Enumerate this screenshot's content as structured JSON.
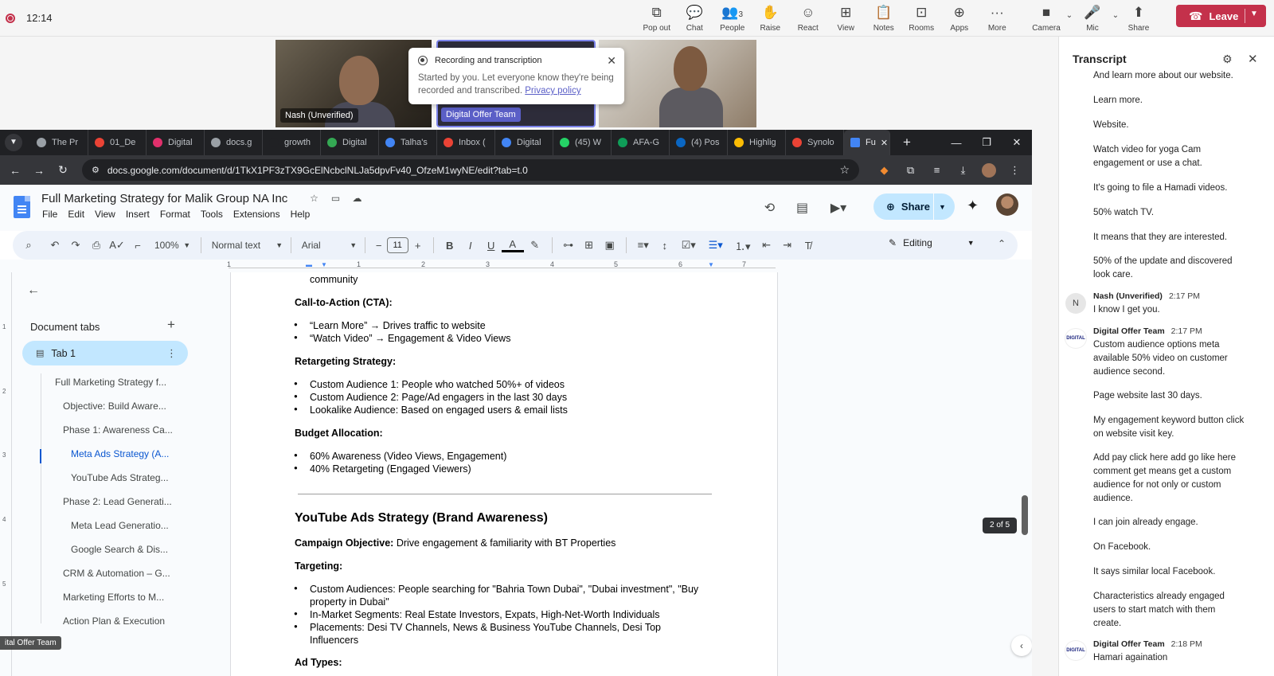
{
  "teams": {
    "clock": "12:14",
    "tools": [
      {
        "icon": "⧉",
        "label": "Pop out"
      },
      {
        "icon": "💬",
        "label": "Chat"
      },
      {
        "icon": "👥",
        "label": "People",
        "badge": "3"
      },
      {
        "icon": "✋",
        "label": "Raise"
      },
      {
        "icon": "☺",
        "label": "React"
      },
      {
        "icon": "⊞",
        "label": "View"
      },
      {
        "icon": "📋",
        "label": "Notes"
      },
      {
        "icon": "⊡",
        "label": "Rooms"
      },
      {
        "icon": "⊕",
        "label": "Apps"
      },
      {
        "icon": "···",
        "label": "More"
      }
    ],
    "av_tools": [
      {
        "icon": "■",
        "label": "Camera"
      },
      {
        "icon": "🎤",
        "label": "Mic"
      },
      {
        "icon": "⬆",
        "label": "Share"
      }
    ],
    "leave_label": "Leave",
    "colors": {
      "leave": "#c4314b",
      "accent": "#5b5fc7"
    }
  },
  "videos": [
    {
      "name": "Nash (Unverified)"
    },
    {
      "name": "Digital Offer Team"
    },
    {
      "name": ""
    }
  ],
  "recording_popup": {
    "title": "Recording and transcription",
    "body": "Started by you. Let everyone know they're being recorded and transcribed.",
    "link": "Privacy policy"
  },
  "chrome": {
    "tabs": [
      {
        "title": "The Pr",
        "color": "#9aa0a6"
      },
      {
        "title": "01_De",
        "color": "#ea4335"
      },
      {
        "title": "Digital",
        "color": "#e1306c"
      },
      {
        "title": "docs.g",
        "color": "#9aa0a6"
      },
      {
        "title": "growth",
        "color": "#202124"
      },
      {
        "title": "Digital",
        "color": "#34a853"
      },
      {
        "title": "Talha's",
        "color": "#4285f4"
      },
      {
        "title": "Inbox (",
        "color": "#ea4335"
      },
      {
        "title": "Digital",
        "color": "#4285f4"
      },
      {
        "title": "(45) W",
        "color": "#25d366"
      },
      {
        "title": "AFA-G",
        "color": "#0f9d58"
      },
      {
        "title": "(4) Pos",
        "color": "#0a66c2"
      },
      {
        "title": "Highlig",
        "color": "#fbbc04"
      },
      {
        "title": "Synolo",
        "color": "#ea4335"
      }
    ],
    "active_tab": "Fu",
    "url": "docs.google.com/document/d/1TkX1PF3zTX9GcElNcbclNLJa5dpvFv40_OfzeM1wyNE/edit?tab=t.0"
  },
  "docs": {
    "title": "Full Marketing Strategy for Malik Group NA Inc",
    "menu": [
      "File",
      "Edit",
      "View",
      "Insert",
      "Format",
      "Tools",
      "Extensions",
      "Help"
    ],
    "share_label": "Share",
    "zoom": "100%",
    "style": "Normal text",
    "font": "Arial",
    "font_size": "11",
    "mode": "Editing",
    "ruler_numbers": [
      "1",
      "1",
      "2",
      "3",
      "4",
      "5",
      "6",
      "7"
    ],
    "vruler_numbers": [
      "1",
      "2",
      "3",
      "4",
      "5"
    ],
    "outline": {
      "title": "Document tabs",
      "tab": "Tab 1",
      "items": [
        "Full Marketing Strategy f...",
        "Objective: Build Aware...",
        "Phase 1: Awareness Ca...",
        "Meta Ads Strategy (A...",
        "YouTube Ads Strateg...",
        "Phase 2: Lead Generati...",
        "Meta Lead Generatio...",
        "Google Search & Dis...",
        "CRM & Automation – G...",
        "Marketing Efforts to M...",
        "Action Plan & Execution"
      ]
    },
    "page": {
      "community": "community",
      "cta_heading": "Call-to-Action (CTA):",
      "cta_items": [
        "“Learn More” → Drives traffic to website",
        "“Watch Video” → Engagement & Video Views"
      ],
      "retargeting_heading": "Retargeting Strategy:",
      "retargeting_items": [
        "Custom Audience 1: People who watched 50%+ of videos",
        "Custom Audience 2: Page/Ad engagers in the last 30 days",
        "Lookalike Audience: Based on engaged users & email lists"
      ],
      "budget_heading": "Budget Allocation:",
      "budget_items": [
        "60% Awareness (Video Views, Engagement)",
        "40% Retargeting (Engaged Viewers)"
      ],
      "youtube_heading": "YouTube Ads Strategy (Brand Awareness)",
      "campaign_label": "Campaign Objective:",
      "campaign_value": "Drive engagement & familiarity with BT Properties",
      "targeting_heading": "Targeting:",
      "targeting_items": [
        "Custom Audiences: People searching for \"Bahria Town Dubai\", \"Dubai investment\", \"Buy",
        "property in Dubai\"",
        "In-Market Segments: Real Estate Investors, Expats, High-Net-Worth Individuals",
        "Placements: Desi TV Channels, News & Business YouTube Channels, Desi Top",
        "Influencers"
      ],
      "ad_types": "Ad Types:"
    },
    "page_counter": "2 of 5",
    "bottom_tag": "ital Offer Team"
  },
  "transcript": {
    "title": "Transcript",
    "lines_top": [
      "And learn more about our website.",
      "Learn more.",
      "Website.",
      "Watch video for yoga Cam engagement or use a chat.",
      "It's going to file a Hamadi videos.",
      "50% watch TV.",
      "It means that they are interested.",
      "50% of the update and discovered look care."
    ],
    "entry1": {
      "avatar": "N",
      "speaker": "Nash (Unverified)",
      "time": "2:17 PM",
      "text": "I know I get you."
    },
    "entry2": {
      "avatar": "DIGITAL",
      "speaker": "Digital Offer Team",
      "time": "2:17 PM",
      "lines": [
        "Custom audience options meta available 50% video on customer audience second.",
        "Page website last 30 days.",
        "My engagement keyword button click on website visit key.",
        "Add pay click here add go like here comment get means get a custom audience for not only or custom audience.",
        "I can join already engage.",
        "On Facebook.",
        "It says similar local Facebook.",
        "Characteristics already engaged users to start match with them create."
      ]
    },
    "entry3": {
      "avatar": "DIGITAL",
      "speaker": "Digital Offer Team",
      "time": "2:18 PM",
      "text": "Hamari againation"
    }
  }
}
